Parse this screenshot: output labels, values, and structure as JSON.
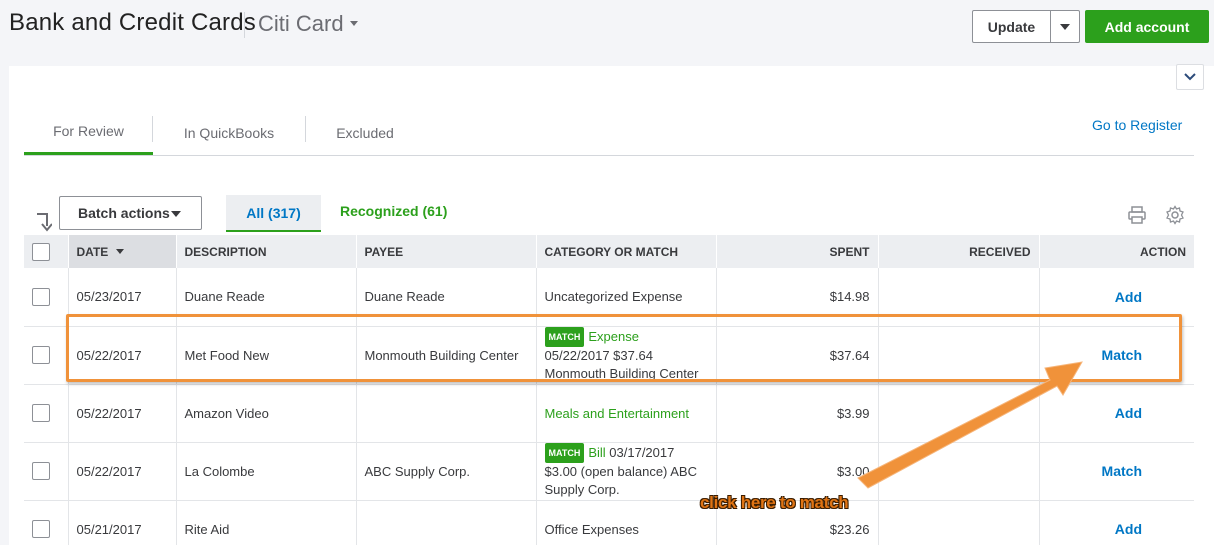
{
  "header": {
    "title": "Bank and Credit Cards",
    "account": "Citi Card",
    "update_label": "Update",
    "add_account_label": "Add account"
  },
  "tabs": [
    {
      "label": "For Review",
      "active": true
    },
    {
      "label": "In QuickBooks",
      "active": false
    },
    {
      "label": "Excluded",
      "active": false
    }
  ],
  "register_link": "Go to Register",
  "toolbar": {
    "batch_actions": "Batch actions",
    "filter_all": "All (317)",
    "filter_recognized": "Recognized (61)"
  },
  "table": {
    "columns": [
      "DATE",
      "DESCRIPTION",
      "PAYEE",
      "CATEGORY OR MATCH",
      "SPENT",
      "RECEIVED",
      "ACTION"
    ],
    "rows": [
      {
        "date": "05/23/2017",
        "description": "Duane Reade",
        "payee": "Duane Reade",
        "category": "Uncategorized Expense",
        "spent": "$14.98",
        "received": "",
        "action": "Add"
      },
      {
        "date": "05/22/2017",
        "description": "Met Food New",
        "payee": "Monmouth Building Center",
        "badge": "MATCH",
        "match_type": "Expense",
        "match_line1": "05/22/2017 $37.64",
        "match_line2": "Monmouth Building Center",
        "spent": "$37.64",
        "received": "",
        "action": "Match"
      },
      {
        "date": "05/22/2017",
        "description": "Amazon Video",
        "payee": "",
        "category": "Meals and Entertainment",
        "spent": "$3.99",
        "received": "",
        "action": "Add"
      },
      {
        "date": "05/22/2017",
        "description": "La Colombe",
        "payee": "ABC Supply Corp.",
        "badge": "MATCH",
        "match_type": "Bill",
        "match_type_date": " 03/17/2017",
        "match_line1": "$3.00 (open balance) ABC",
        "match_line2": "Supply Corp.",
        "spent": "$3.00",
        "received": "",
        "action": "Match"
      },
      {
        "date": "05/21/2017",
        "description": "Rite Aid",
        "payee": "",
        "category": "Office Expenses",
        "spent": "$23.26",
        "received": "",
        "action": "Add"
      }
    ]
  },
  "annotation": {
    "text": "click here to match",
    "color": "#f0923a"
  },
  "colors": {
    "accent_green": "#2ca01c",
    "link_blue": "#0077c5",
    "annotation_orange": "#f0923a"
  }
}
